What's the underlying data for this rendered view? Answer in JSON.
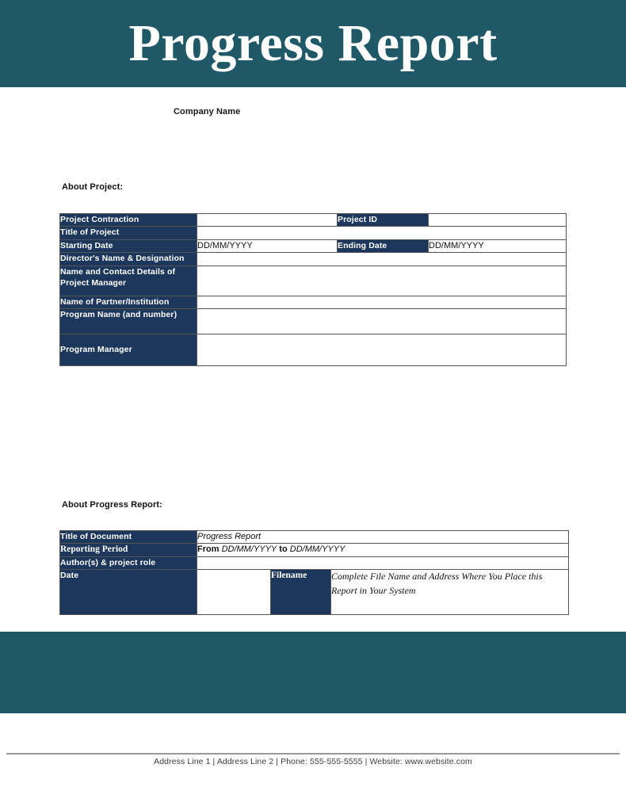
{
  "document": {
    "title": "Progress Report",
    "company_name": "Company Name"
  },
  "sections": {
    "about_project": {
      "heading": "About Project:",
      "rows": [
        {
          "label": "Project Contraction",
          "value": "",
          "label2": "Project ID",
          "value2": ""
        },
        {
          "label": "Title of Project",
          "value": ""
        },
        {
          "label": "Starting Date",
          "value": "DD/MM/YYYY",
          "label2": "Ending Date",
          "value2": "DD/MM/YYYY"
        },
        {
          "label": "Director's Name & Designation",
          "value": ""
        },
        {
          "label": "Name and Contact Details of Project Manager",
          "value": ""
        },
        {
          "label": "Name of Partner/Institution",
          "value": ""
        },
        {
          "label": "Program Name (and number)",
          "value": ""
        },
        {
          "label": "Program Manager",
          "value": ""
        }
      ]
    },
    "about_progress_report": {
      "heading": "About Progress Report:",
      "rows": [
        {
          "label": "Title of Document",
          "value": "Progress Report"
        },
        {
          "label": "Reporting Period",
          "value_prefix": "From ",
          "value_date_start": "DD/MM/YYYY",
          "value_middle": " to ",
          "value_date_end": "DD/MM/YYYY"
        },
        {
          "label": "Author(s) & project role",
          "value": ""
        },
        {
          "label": "Date",
          "value": "",
          "label2": "Filename",
          "value2": "Complete File Name and Address Where You Place this Report in Your System"
        }
      ]
    }
  },
  "footer": {
    "text": "Address Line 1 | Address Line 2 | Phone: 555-555-5555 | Website: www.website.com"
  },
  "colors": {
    "band_teal": "#1F5867",
    "label_navy": "#1C365C",
    "page_white": "#FFFFFF",
    "border_gray": "#555555"
  }
}
